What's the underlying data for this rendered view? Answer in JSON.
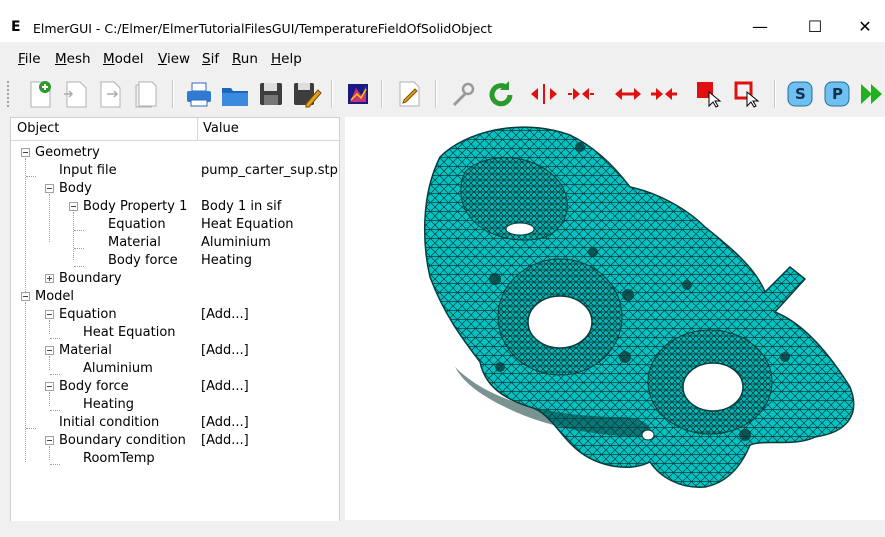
{
  "window": {
    "app_icon": "E",
    "title": "ElmerGUI - C:/Elmer/ElmerTutorialFilesGUI/TemperatureFieldOfSolidObject",
    "minimize": "—",
    "maximize": "☐",
    "close": "✕"
  },
  "menu": [
    {
      "key": "F",
      "rest": "ile"
    },
    {
      "key": "M",
      "rest": "esh"
    },
    {
      "key": "M",
      "rest": "odel"
    },
    {
      "key": "V",
      "rest": "iew"
    },
    {
      "key": "S",
      "rest": "if"
    },
    {
      "key": "R",
      "rest": "un"
    },
    {
      "key": "H",
      "rest": "elp"
    }
  ],
  "toolbar": {
    "icons": [
      "new-document-icon",
      "open-document-icon",
      "load-document-icon",
      "save-document-icon",
      "printer-icon",
      "open-folder-icon",
      "save-disk-icon",
      "save-as-icon",
      "surface-icon",
      "edit-sif-icon",
      "tools-icon",
      "refresh-icon",
      "divide-horizontal-icon",
      "unify-horizontal-icon",
      "divide-edges-icon",
      "unify-edges-icon",
      "select-surface-icon",
      "select-edge-icon",
      "solver-icon",
      "parallel-icon",
      "run-icon"
    ],
    "solver_label": "S",
    "parallel_label": "P"
  },
  "tree": {
    "headers": {
      "object": "Object",
      "value": "Value"
    },
    "rows": [
      {
        "label": "Geometry",
        "value": ""
      },
      {
        "label": "Input file",
        "value": "pump_carter_sup.stp"
      },
      {
        "label": "Body",
        "value": ""
      },
      {
        "label": "Body Property 1",
        "value": "Body 1 in sif"
      },
      {
        "label": "Equation",
        "value": "Heat Equation"
      },
      {
        "label": "Material",
        "value": "Aluminium"
      },
      {
        "label": "Body force",
        "value": "Heating"
      },
      {
        "label": "Boundary",
        "value": ""
      },
      {
        "label": "Model",
        "value": ""
      },
      {
        "label": "Equation",
        "value": "[Add...]"
      },
      {
        "label": "Heat Equation",
        "value": ""
      },
      {
        "label": "Material",
        "value": "[Add...]"
      },
      {
        "label": "Aluminium",
        "value": ""
      },
      {
        "label": "Body force",
        "value": "[Add...]"
      },
      {
        "label": "Heating",
        "value": ""
      },
      {
        "label": "Initial condition",
        "value": "[Add...]"
      },
      {
        "label": "Boundary condition",
        "value": "[Add...]"
      },
      {
        "label": "RoomTemp",
        "value": ""
      }
    ]
  },
  "viewport": {
    "mesh_color": "#00c4c4",
    "mesh_line_color": "#0b3b3b"
  }
}
